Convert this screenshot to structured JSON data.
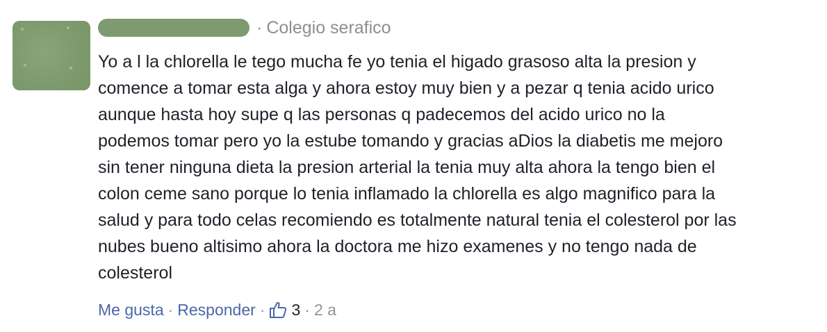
{
  "comment": {
    "author_redacted": true,
    "separator": "·",
    "group": "Colegio serafico",
    "text_lines": [
      "Yo a l la chlorella le tego mucha fe yo tenia el higado grasoso alta la presion y",
      "comence a tomar esta alga y ahora estoy muy bien y a pezar q tenia acido urico",
      "aunque hasta hoy supe q las personas q padecemos del acido urico no la",
      "podemos tomar pero yo la estube tomando y gracias aDios la diabetis me mejoro",
      "sin tener ninguna dieta la presion arterial la tenia muy alta ahora la tengo bien el",
      "colon ceme sano porque lo tenia inflamado la chlorella es algo magnifico para la",
      "salud y para todo celas recomiendo es totalmente natural tenia el colesterol por las",
      "nubes bueno altisimo ahora la doctora me hizo examenes y no tengo nada de",
      "colesterol"
    ],
    "actions": {
      "like_label": "Me gusta",
      "reply_label": "Responder",
      "like_count": "3",
      "time_ago": "2 a",
      "dot": "·"
    },
    "colors": {
      "link": "#4b67a8",
      "text": "#1d2129",
      "meta": "#8e8e8e",
      "redaction": "#7d9b6e"
    },
    "icons": {
      "like": "thumbs-up-icon"
    }
  }
}
